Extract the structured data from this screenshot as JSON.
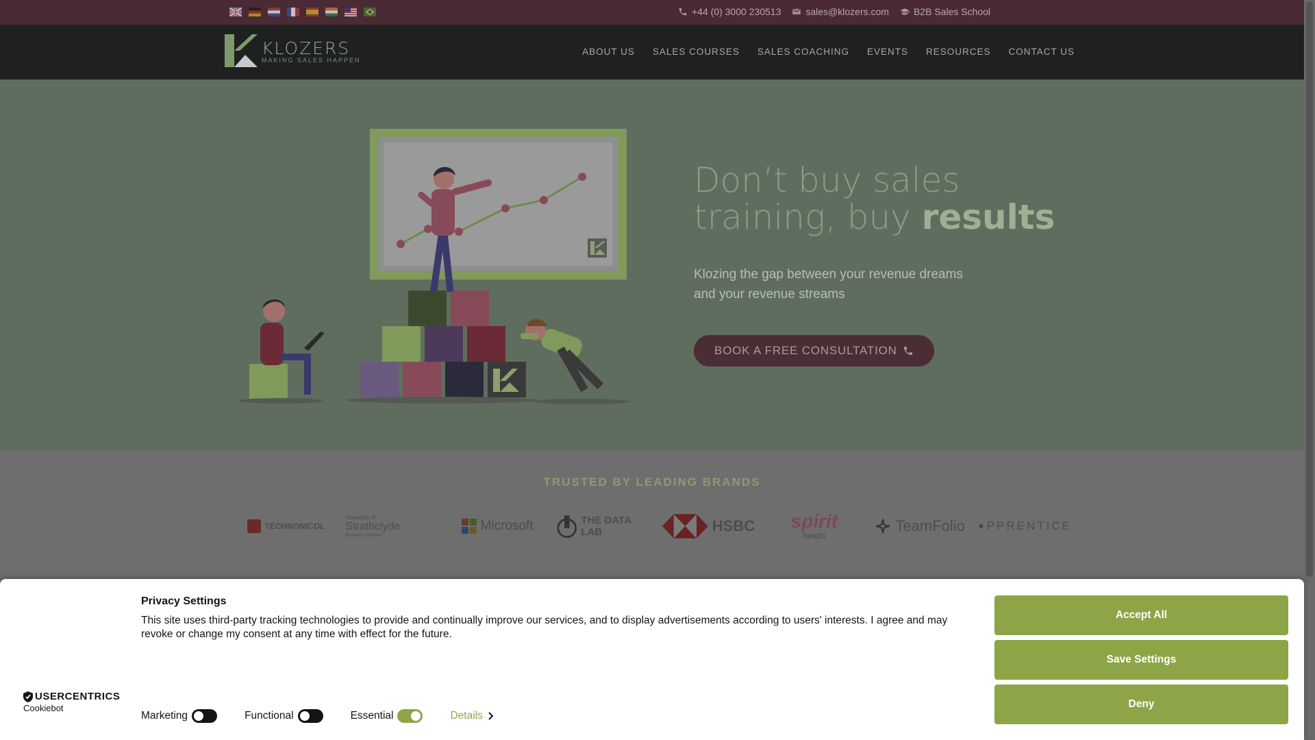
{
  "topbar": {
    "flags": [
      "uk-flag",
      "germany-flag",
      "netherlands-flag",
      "france-flag",
      "spain-flag",
      "india-flag",
      "malaysia-flag",
      "brazil-flag"
    ],
    "phone": "+44 (0) 3000 230513",
    "email": "sales@klozers.com",
    "school": "B2B Sales School"
  },
  "nav": {
    "logo_name": "KLOZERS",
    "logo_tagline": "MAKING SALES HAPPEN",
    "items": [
      "ABOUT US",
      "SALES COURSES",
      "SALES COACHING",
      "EVENTS",
      "RESOURCES",
      "CONTACT US"
    ]
  },
  "hero": {
    "title_part1": "Don’t buy sales",
    "title_part2": "training, buy ",
    "title_bold": "results",
    "subtitle": "Klozing the gap between your revenue dreams and your revenue streams",
    "cta": "BOOK A FREE CONSULTATION"
  },
  "brands": {
    "title": "TRUSTED BY LEADING BRANDS",
    "row1": [
      "TECHNONICOL",
      "Strathclyde",
      "Microsoft",
      "THE DATA LAB",
      "HSBC",
      "spirit",
      "TeamFolio",
      "PPRENTICE"
    ],
    "row1_extra": {
      "strathclyde_top": "University of",
      "strathclyde_bottom": "Business School",
      "spirit_sub": "health"
    }
  },
  "cookie": {
    "title": "Privacy Settings",
    "text": "This site uses third-party tracking technologies to provide and continually improve our services, and to display advertisements according to users' interests. I agree and may revoke or change my consent at any time with effect for the future.",
    "brand_name": "USERCENTRICS",
    "brand_sub": "Cookiebot",
    "toggles": [
      {
        "label": "Marketing",
        "on": false
      },
      {
        "label": "Functional",
        "on": false
      },
      {
        "label": "Essential",
        "on": true
      }
    ],
    "details": "Details",
    "accept_all": "Accept All",
    "save_settings": "Save Settings",
    "deny": "Deny",
    "accent": "#8da547"
  }
}
